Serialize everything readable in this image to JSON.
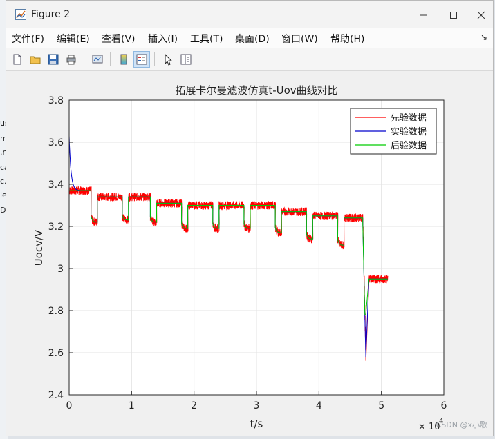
{
  "window": {
    "title": "Figure 2"
  },
  "menu": [
    {
      "label": "文件(F)"
    },
    {
      "label": "编辑(E)"
    },
    {
      "label": "查看(V)"
    },
    {
      "label": "插入(I)"
    },
    {
      "label": "工具(T)"
    },
    {
      "label": "桌面(D)"
    },
    {
      "label": "窗口(W)"
    },
    {
      "label": "帮助(H)"
    }
  ],
  "toolbar": [
    "new-figure-icon",
    "open-icon",
    "save-icon",
    "print-icon",
    "link-plot-icon",
    "colorbar-icon",
    "legend-icon",
    "pointer-icon",
    "property-inspector-icon"
  ],
  "backdrop": {
    "left_labels": [
      "us",
      "m",
      ".m",
      "ca",
      "c.",
      "le",
      "D"
    ]
  },
  "watermark": "CSDN @x小歌",
  "colors": {
    "prior": "#ff0000",
    "experiment": "#0000cc",
    "posterior": "#00cc00"
  },
  "chart_data": {
    "type": "line",
    "title": "拓展卡尔曼滤波仿真t-Uov曲线对比",
    "xlabel": "t/s",
    "ylabel": "Uocv/V",
    "x_exponent_label": "× 10",
    "x_exponent": "4",
    "xlim": [
      0,
      6
    ],
    "ylim": [
      2.4,
      3.8
    ],
    "xticks": [
      "0",
      "1",
      "2",
      "3",
      "4",
      "5",
      "6"
    ],
    "yticks": [
      "2.4",
      "2.6",
      "2.8",
      "3",
      "3.2",
      "3.4",
      "3.6",
      "3.8"
    ],
    "grid": true,
    "legend_position": "top-right",
    "x_units": "×10^4 s",
    "pulse_segments": [
      {
        "x0": 0.0,
        "x1": 0.35,
        "rest": 3.37,
        "low_x1": 0.45,
        "low": 3.22
      },
      {
        "x0": 0.45,
        "x1": 0.85,
        "rest": 3.34,
        "low_x1": 0.95,
        "low": 3.23
      },
      {
        "x0": 0.95,
        "x1": 1.3,
        "rest": 3.34,
        "low_x1": 1.4,
        "low": 3.22
      },
      {
        "x0": 1.4,
        "x1": 1.8,
        "rest": 3.31,
        "low_x1": 1.9,
        "low": 3.19
      },
      {
        "x0": 1.9,
        "x1": 2.3,
        "rest": 3.3,
        "low_x1": 2.4,
        "low": 3.19
      },
      {
        "x0": 2.4,
        "x1": 2.8,
        "rest": 3.3,
        "low_x1": 2.9,
        "low": 3.19
      },
      {
        "x0": 2.9,
        "x1": 3.3,
        "rest": 3.3,
        "low_x1": 3.4,
        "low": 3.17
      },
      {
        "x0": 3.4,
        "x1": 3.8,
        "rest": 3.27,
        "low_x1": 3.9,
        "low": 3.14
      },
      {
        "x0": 3.9,
        "x1": 4.3,
        "rest": 3.25,
        "low_x1": 4.4,
        "low": 3.11
      },
      {
        "x0": 4.4,
        "x1": 4.7,
        "rest": 3.24,
        "low_x1": 4.75,
        "low": 2.58
      },
      {
        "x0": 4.8,
        "x1": 5.1,
        "rest": 2.95,
        "low_x1": 5.1,
        "low": 2.95
      }
    ],
    "initial_spike": 3.63,
    "series": [
      {
        "name": "先验数据",
        "color": "#ff0000",
        "noise": 0.02
      },
      {
        "name": "实验数据",
        "color": "#0000cc",
        "noise": 0.0
      },
      {
        "name": "后验数据",
        "color": "#00cc00",
        "noise": 0.0
      }
    ]
  }
}
